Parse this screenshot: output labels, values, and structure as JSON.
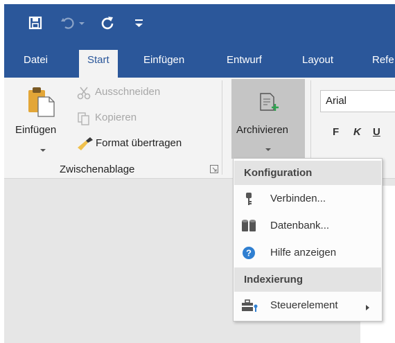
{
  "quick_access": {
    "save_icon": "save-icon",
    "undo_icon": "undo-icon",
    "repeat_icon": "repeat-icon",
    "customize_icon": "customize-qat-icon"
  },
  "tabs": [
    {
      "label": "Datei"
    },
    {
      "label": "Start"
    },
    {
      "label": "Einfügen"
    },
    {
      "label": "Entwurf"
    },
    {
      "label": "Layout"
    },
    {
      "label": "Refe"
    }
  ],
  "clipboard": {
    "paste": "Einfügen",
    "cut": "Ausschneiden",
    "copy": "Kopieren",
    "format_painter": "Format übertragen",
    "group_label": "Zwischenablage"
  },
  "archive": {
    "label": "Archivieren"
  },
  "font": {
    "name": "Arial",
    "bold": "F",
    "italic": "K",
    "underline": "U"
  },
  "menu": {
    "section1": "Konfiguration",
    "connect": "Verbinden...",
    "database": "Datenbank...",
    "help": "Hilfe anzeigen",
    "section2": "Indexierung",
    "control": "Steuerelement"
  },
  "colors": {
    "accent": "#2b579a",
    "ribbon_bg": "#f3f3f3",
    "help_icon": "#2f7fd1"
  }
}
